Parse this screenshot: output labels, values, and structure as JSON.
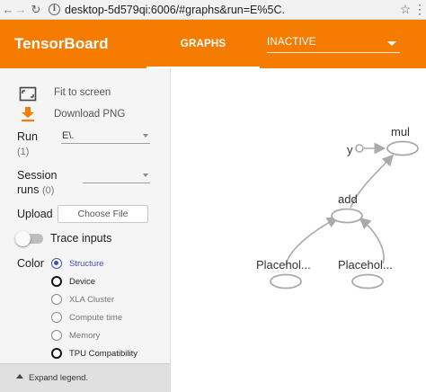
{
  "browser": {
    "url": "desktop-5d579qi:6006/#graphs&run=E%5C.",
    "info_glyph": "i",
    "back_glyph": "←",
    "forward_glyph": "→",
    "reload_glyph": "↻",
    "star_glyph": "☆",
    "menu_glyph": "⋮"
  },
  "header": {
    "brand": "TensorBoard",
    "tab_graphs": "GRAPHS",
    "run_value": "INACTIVE",
    "color": "#f57c00"
  },
  "sidebar": {
    "fit_to_screen": "Fit to screen",
    "download_png": "Download PNG",
    "run_label": "Run",
    "run_count": "(1)",
    "run_value": "E\\.",
    "session_label_1": "Session",
    "session_label_2": "runs",
    "session_count": "(0)",
    "upload_label": "Upload",
    "choose_file": "Choose File",
    "trace_inputs": "Trace inputs",
    "color_label": "Color",
    "color_options": [
      {
        "label": "Structure",
        "selected": true
      },
      {
        "label": "Device",
        "selected": false
      },
      {
        "label": "XLA Cluster",
        "selected": false
      },
      {
        "label": "Compute time",
        "selected": false
      },
      {
        "label": "Memory",
        "selected": false
      },
      {
        "label": "TPU Compatibility",
        "selected": false
      }
    ],
    "expand_legend": "Expand legend."
  },
  "graph": {
    "nodes": {
      "mul": "mul",
      "y": "y",
      "add": "add",
      "placeholder_left": "Placehol...",
      "placeholder_right": "Placehol..."
    }
  }
}
